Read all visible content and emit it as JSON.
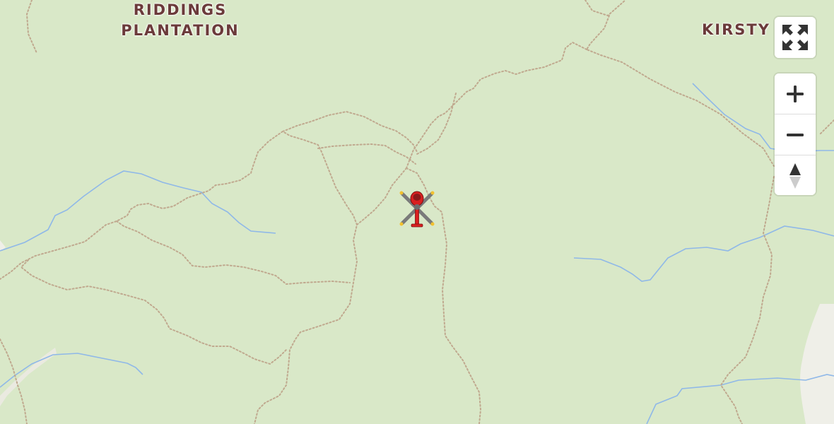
{
  "map": {
    "labels": {
      "riddings": "RIDDINGS\nPLANTATION",
      "kirsty": "KIRSTY W"
    },
    "marker": {
      "icon": "helicopter-icon"
    },
    "colors": {
      "background": "#d9e8c8",
      "path": "#c0a98f",
      "stream": "#8fb8e8",
      "label": "#6b3a3a",
      "open_land": "#efefe8"
    }
  },
  "controls": {
    "fullscreen": {
      "icon": "fullscreen-icon"
    },
    "zoom_in": {
      "icon": "plus-icon"
    },
    "zoom_out": {
      "icon": "minus-icon"
    },
    "compass": {
      "icon": "compass-icon"
    }
  }
}
